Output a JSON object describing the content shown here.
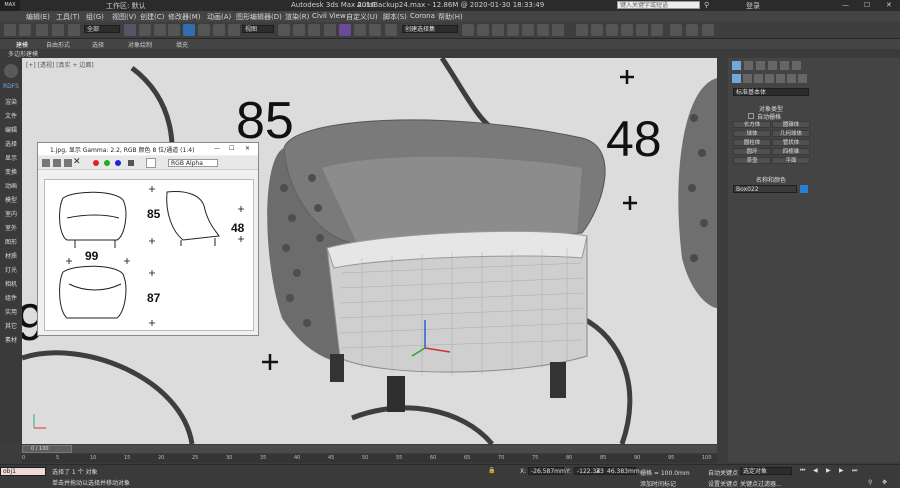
{
  "title": {
    "app": "Autodesk 3ds Max 2016",
    "file": "AutoBackup24.max - 12.86M @ 2020-01-30 18:33:49",
    "search_placeholder": "键入关键字或短语",
    "login": "登录",
    "workspace": "工作区: 默认",
    "logo": "MAX"
  },
  "menu": [
    "编辑(E)",
    "工具(T)",
    "组(G)",
    "视图(V)",
    "创建(C)",
    "修改器(M)",
    "动画(A)",
    "图形编辑器(D)",
    "渲染(R)",
    "Civil View",
    "自定义(U)",
    "脚本(S)",
    "Corona",
    "帮助(H)"
  ],
  "toolbar": {
    "selection_filter": "全部",
    "view_dropdown": "视图",
    "selection_set": "创建选择集"
  },
  "ribbon": {
    "tabs": [
      "建模",
      "自由形式",
      "选择",
      "对象绘制",
      "填充"
    ],
    "sub": "多边形建模"
  },
  "left_commands": [
    "RDFS",
    "渲染",
    "文件",
    "编辑",
    "选择",
    "显示",
    "变换",
    "动画",
    "模型",
    "室内",
    "室外",
    "图形",
    "材质",
    "灯光",
    "相机",
    "组件",
    "实用",
    "其它",
    "素材"
  ],
  "viewport": {
    "label": "[+] [透视] [真实 + 边面]",
    "labels": [
      "85",
      "48",
      "9"
    ]
  },
  "image_window": {
    "title": "1.jpg, 显示 Gamma: 2.2, RGB 颜色 8 位/通道 (1:4)",
    "channel": "RGB Alpha",
    "dims": [
      "85",
      "48",
      "99",
      "87"
    ]
  },
  "right_panel": {
    "dropdown": "标准基本体",
    "object_type_header": "对象类型",
    "autogrid": "自动栅格",
    "buttons": [
      "长方体",
      "圆锥体",
      "球体",
      "几何球体",
      "圆柱体",
      "管状体",
      "圆环",
      "四棱锥",
      "茶壶",
      "平面"
    ],
    "name_color_header": "名称和颜色",
    "name_value": "Box022",
    "color": "#2a7fd4"
  },
  "timeline": {
    "frame": "0 / 100",
    "ticks": [
      "0",
      "5",
      "10",
      "15",
      "20",
      "25",
      "30",
      "35",
      "40",
      "45",
      "50",
      "55",
      "60",
      "65",
      "70",
      "75",
      "80",
      "85",
      "90",
      "95",
      "100"
    ]
  },
  "status": {
    "msg1": "选择了 1 个 对象",
    "msg2": "单击并拖动以选择并移动对象",
    "x_label": "X:",
    "x": "-26.587mm",
    "y_label": "Y:",
    "y": "-122.343mm",
    "z_label": "Z:",
    "z": "46.383mm",
    "grid": "栅格 = 100.0mm",
    "add_tag": "添加时间标记",
    "autokey": "自动关键点",
    "setkey": "设置关键点",
    "select_obj": "选定对象",
    "key_filter": "关键点过滤器...",
    "script": "obj1"
  }
}
